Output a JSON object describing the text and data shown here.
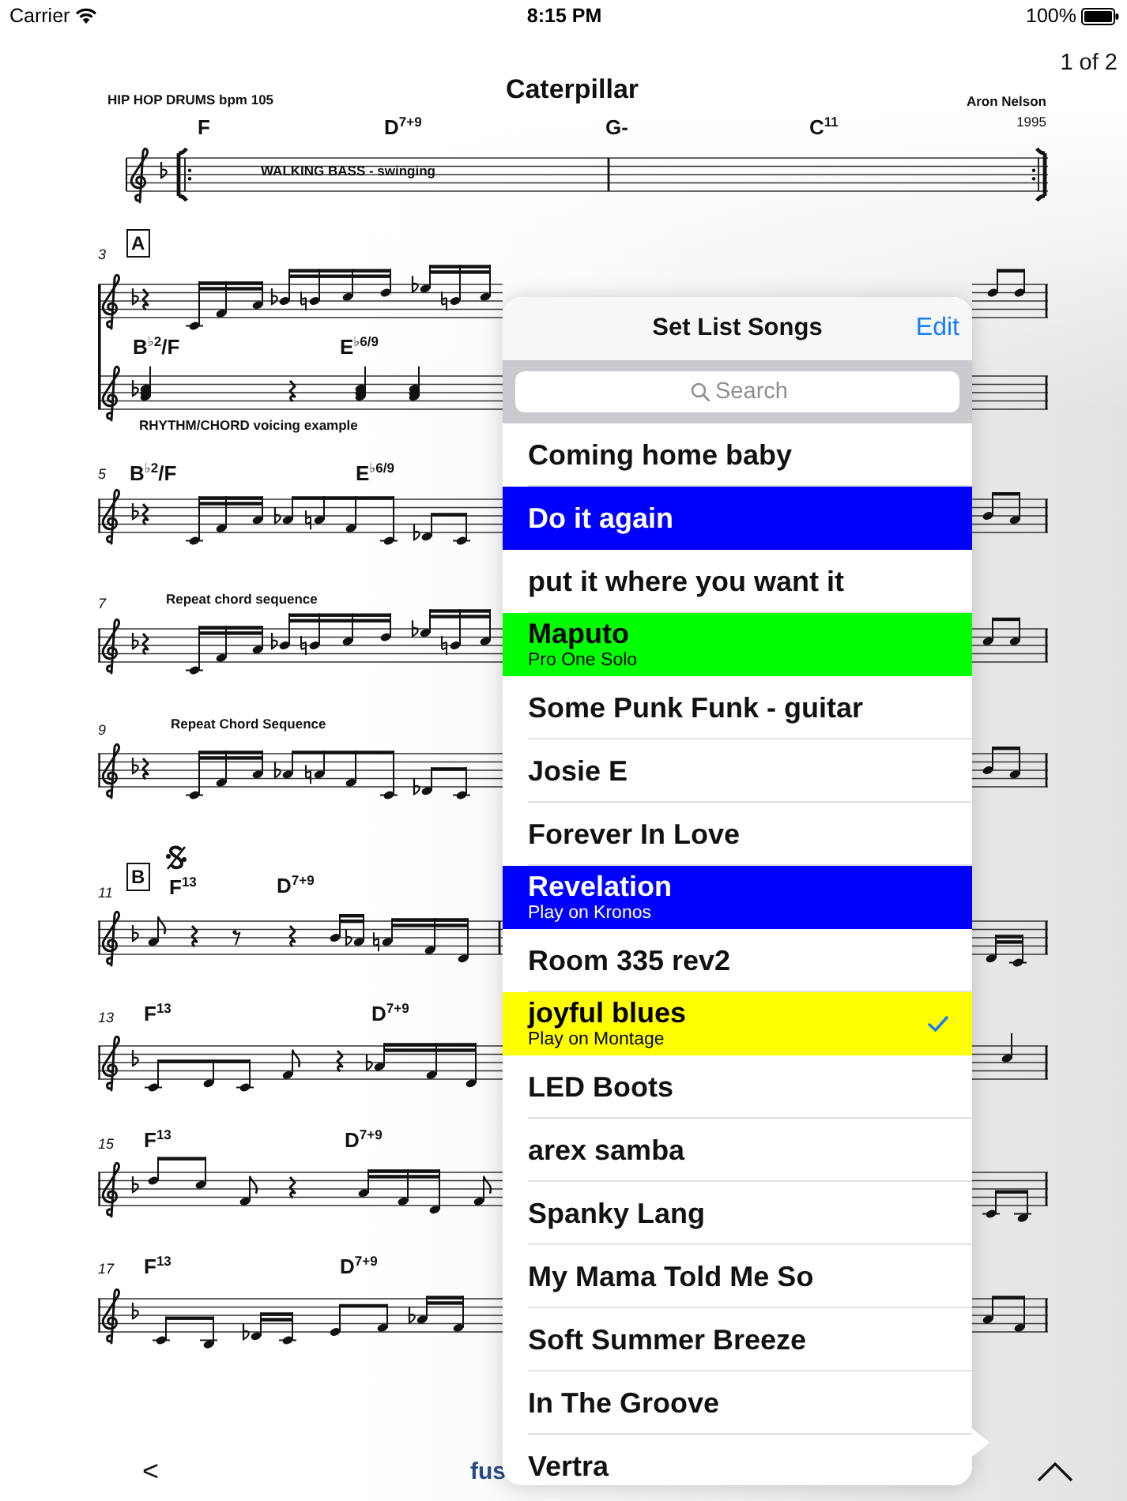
{
  "status_bar": {
    "carrier": "Carrier",
    "time": "8:15 PM",
    "battery": "100%"
  },
  "page_indicator": "1 of 2",
  "score": {
    "groove": "HIP HOP DRUMS bpm 105",
    "title": "Caterpillar",
    "composer": "Aron Nelson",
    "year": "1995",
    "systems": [
      {
        "chords": [
          "F",
          "D$^{7+9}$",
          "G-",
          "C$^{11}$"
        ],
        "annotation": "WALKING BASS - swinging",
        "segno": false
      },
      {
        "measure": "3",
        "rehearsal_mark": "A",
        "chords": [
          "B$^{♭2}$/F",
          "E$^{♭6/9}$"
        ],
        "annotation": "RHYTHM/CHORD voicing example",
        "segno": false
      },
      {
        "measure": "5",
        "chords": [
          "B$^{♭2}$/F",
          "E$^{♭6/9}$"
        ],
        "segno": false
      },
      {
        "measure": "7",
        "annotation": "Repeat chord sequence",
        "segno": false
      },
      {
        "measure": "9",
        "annotation": "Repeat Chord Sequence",
        "segno": false
      },
      {
        "measure": "11",
        "rehearsal_mark": "B",
        "chords": [
          "F$^{13}$",
          "D$^{7+9}$"
        ],
        "segno": true
      },
      {
        "measure": "13",
        "chords": [
          "F$^{13}$",
          "D$^{7+9}$"
        ],
        "segno": false
      },
      {
        "measure": "15",
        "chords": [
          "F$^{13}$",
          "D$^{7+9}$"
        ],
        "segno": false
      },
      {
        "measure": "17",
        "chords": [
          "F$^{13}$",
          "D$^{7+9}$"
        ],
        "segno": false
      }
    ]
  },
  "toolbar": {
    "back": "<",
    "label": "fus"
  },
  "popover": {
    "title": "Set List Songs",
    "edit": "Edit",
    "search": {
      "placeholder": "Search"
    },
    "songs": [
      {
        "title": "Coming home baby",
        "checked": false
      },
      {
        "title": "Do it again",
        "color": "#0000ff",
        "checked": false
      },
      {
        "title": "put it where you want it",
        "checked": false
      },
      {
        "title": "Maputo",
        "subtitle": "Pro One Solo",
        "color": "#00ff00",
        "checked": false
      },
      {
        "title": "Some Punk Funk - guitar",
        "checked": false
      },
      {
        "title": "Josie E",
        "checked": false
      },
      {
        "title": "Forever In Love",
        "checked": false
      },
      {
        "title": "Revelation",
        "subtitle": "Play on Kronos",
        "color": "#0000ff",
        "checked": false
      },
      {
        "title": "Room 335 rev2",
        "checked": false
      },
      {
        "title": "joyful blues",
        "subtitle": "Play on Montage",
        "color": "#ffff00",
        "checked": true
      },
      {
        "title": "LED Boots",
        "checked": false
      },
      {
        "title": "arex samba",
        "checked": false
      },
      {
        "title": "Spanky Lang",
        "checked": false
      },
      {
        "title": "My Mama Told Me So",
        "checked": false
      },
      {
        "title": "Soft Summer Breeze",
        "checked": false
      },
      {
        "title": "In The Groove",
        "checked": false
      },
      {
        "title": "Vertra",
        "checked": false
      }
    ]
  }
}
